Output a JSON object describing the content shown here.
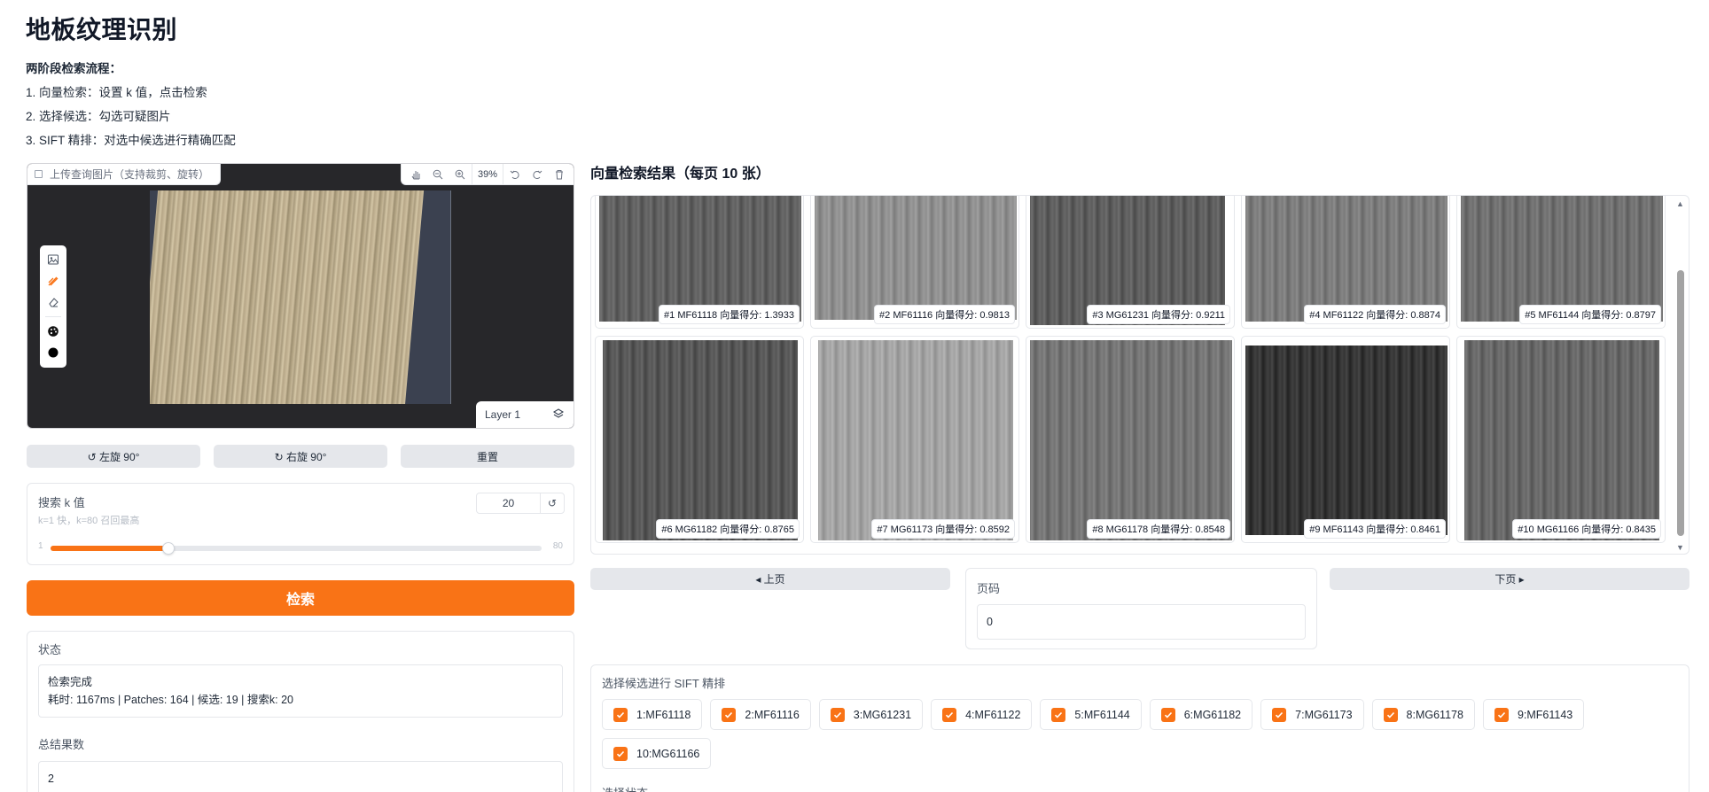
{
  "page": {
    "title": "地板纹理识别"
  },
  "instructions": {
    "heading": "两阶段检索流程：",
    "steps": [
      "1. 向量检索：设置 k 值，点击检索",
      "2. 选择候选：勾选可疑图片",
      "3. SIFT 精排：对选中候选进行精确匹配"
    ]
  },
  "editor": {
    "upload_label": "上传查询图片（支持裁剪、旋转）",
    "zoom": "39%",
    "layer_label": "Layer 1",
    "toolbar_icons": [
      "pan-icon",
      "zoom-out-icon",
      "zoom-in-icon",
      "undo-icon",
      "redo-icon",
      "trash-icon"
    ],
    "side_tool_icons": [
      "image-icon",
      "brush-icon",
      "eraser-icon",
      "palette-icon",
      "color-dot-icon"
    ]
  },
  "actions": {
    "rotate_left": "↺ 左旋 90°",
    "rotate_right": "↻ 右旋 90°",
    "reset": "重置"
  },
  "k_slider": {
    "label": "搜索 k 值",
    "info": "k=1 快，k=80 召回最高",
    "value": "20",
    "min": "1",
    "max": "80",
    "fraction": 0.24,
    "reset_icon": "↺"
  },
  "search_button": "检索",
  "status": {
    "label": "状态",
    "line1": "检索完成",
    "line2": "耗时: 1167ms | Patches: 164 | 候选: 19 | 搜索k: 20"
  },
  "total": {
    "label": "总结果数",
    "value": "2"
  },
  "results": {
    "title": "向量检索结果（每页 10 张）",
    "items": [
      {
        "caption": "#1 MF61118 向量得分: 1.3933",
        "tone": "#5f5f5f"
      },
      {
        "caption": "#2 MF61116 向量得分: 0.9813",
        "tone": "#8e8e8e"
      },
      {
        "caption": "#3 MG61231 向量得分: 0.9211",
        "tone": "#5c5c5c"
      },
      {
        "caption": "#4 MF61122 向量得分: 0.8874",
        "tone": "#7a7a7a"
      },
      {
        "caption": "#5 MF61144 向量得分: 0.8797",
        "tone": "#6e6e6e"
      },
      {
        "caption": "#6 MG61182 向量得分: 0.8765",
        "tone": "#555555"
      },
      {
        "caption": "#7 MG61173 向量得分: 0.8592",
        "tone": "#a2a2a2"
      },
      {
        "caption": "#8 MG61178 向量得分: 0.8548",
        "tone": "#737373"
      },
      {
        "caption": "#9 MF61143 向量得分: 0.8461",
        "tone": "#343434"
      },
      {
        "caption": "#10 MG61166 向量得分: 0.8435",
        "tone": "#666666"
      }
    ]
  },
  "pagination": {
    "prev": "◂ 上页",
    "next": "下页 ▸",
    "page_label": "页码",
    "page_value": "0"
  },
  "candidates": {
    "label": "选择候选进行 SIFT 精排",
    "items": [
      "1:MF61118",
      "2:MF61116",
      "3:MG61231",
      "4:MF61122",
      "5:MF61144",
      "6:MG61182",
      "7:MG61173",
      "8:MG61178",
      "9:MF61143",
      "10:MG61166"
    ],
    "select_status_label": "选择状态"
  },
  "colors": {
    "accent": "#f97316",
    "editor_bg": "#27272a"
  }
}
